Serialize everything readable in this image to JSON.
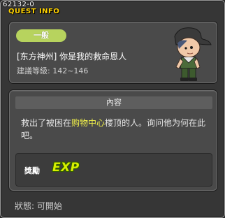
{
  "window": {
    "quest_id": "62132-0",
    "title": "QUEST INFO"
  },
  "header": {
    "category": "一般",
    "quest_name": "[东方神州] 你是我的救命恩人",
    "required_level": "建議等級: 142~146"
  },
  "content": {
    "title": "內容",
    "desc_before": "救出了被困在",
    "desc_highlight": "购物中心",
    "desc_after": "楼顶的人。询问他为何在此吧。",
    "reward_label": "獎勵",
    "reward_exp": "EXP"
  },
  "status": {
    "text": "狀態: 可開始"
  },
  "colors": {
    "background": "#363636",
    "panel": "#4a4a4a",
    "category_badge": "#b7d35e",
    "highlight": "#f2f24a",
    "title_label": "#ffd200",
    "exp": "#d8f000"
  },
  "icons": {
    "character": "character-portrait"
  }
}
